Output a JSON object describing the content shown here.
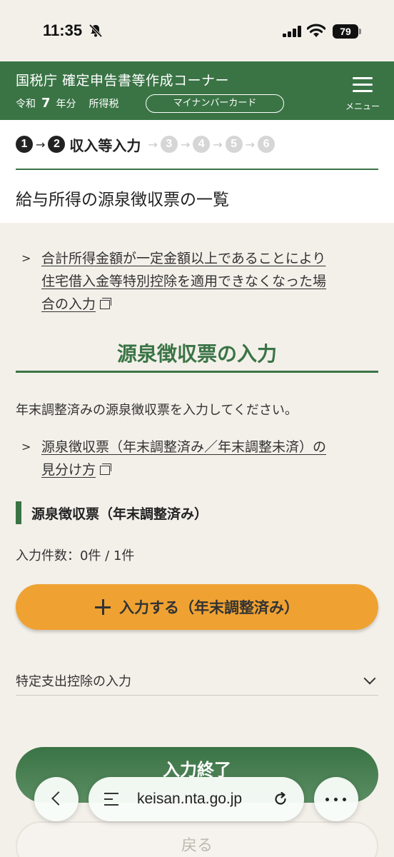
{
  "status_bar": {
    "time": "11:35",
    "battery": "79"
  },
  "header": {
    "title": "国税庁 確定申告書等作成コーナー",
    "era": "令和",
    "year": "7",
    "year_suffix": "年分",
    "tax_type": "所得税",
    "mynumber_button": "マイナンバーカード",
    "menu_label": "メニュー"
  },
  "steps": {
    "items": [
      "1",
      "2",
      "3",
      "4",
      "5",
      "6"
    ],
    "current_label": "収入等入力"
  },
  "page_heading": "給与所得の源泉徴収票の一覧",
  "links": {
    "notice_line1": "合計所得金額が一定金額以上であることにより",
    "notice_line2": "住宅借入金等特別控除を適用できなくなった場",
    "notice_line3": "合の入力",
    "distinguish_line1": "源泉徴収票（年末調整済み／年末調整未済）の",
    "distinguish_line2": "見分け方"
  },
  "section_title": "源泉徴収票の入力",
  "instruction": "年末調整済みの源泉徴収票を入力してください。",
  "sub_heading": "源泉徴収票（年末調整済み）",
  "count_text": "入力件数：0件 / 1件",
  "input_button": "入力する（年末調整済み）",
  "accordion_label": "特定支出控除の入力",
  "finish_button": "入力終了",
  "back_button": "戻る",
  "browser": {
    "url": "keisan.nta.go.jp"
  },
  "colors": {
    "brand_green": "#3a7445",
    "accent_orange": "#efa232",
    "background": "#f3f0ea"
  }
}
